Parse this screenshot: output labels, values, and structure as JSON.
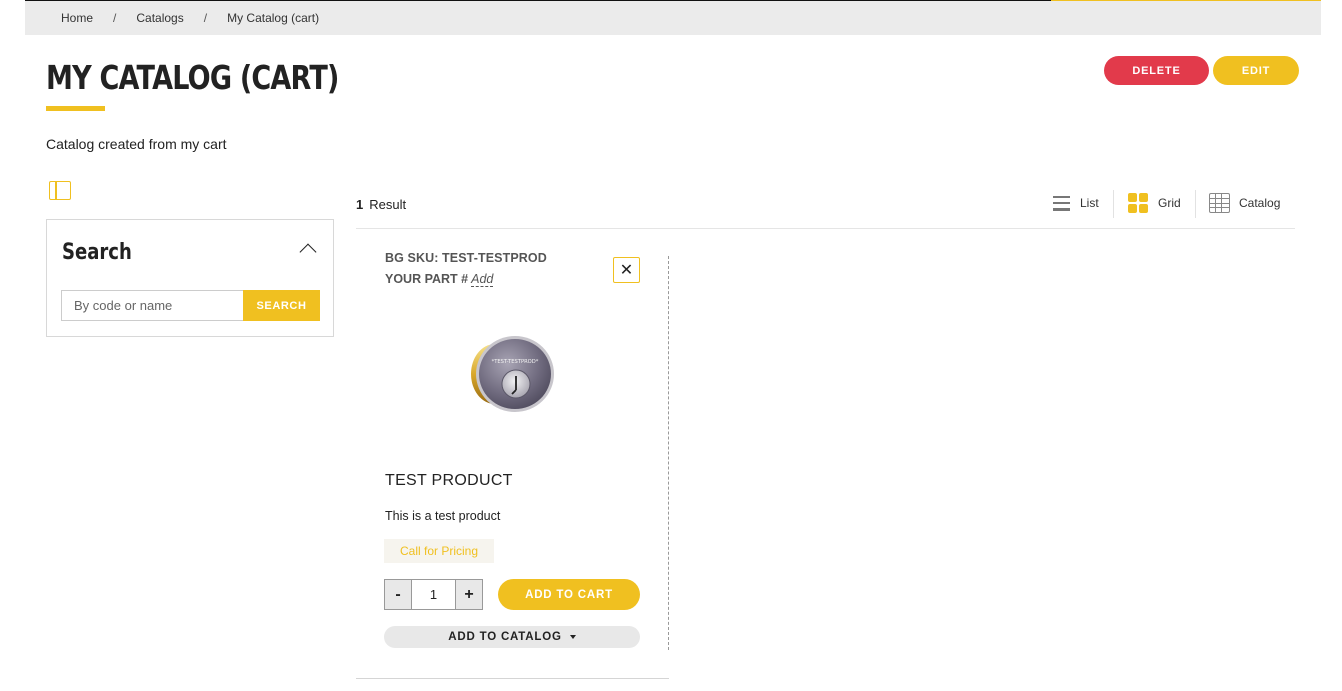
{
  "breadcrumb": {
    "items": [
      "Home",
      "Catalogs",
      "My Catalog (cart)"
    ],
    "separator": "/"
  },
  "page": {
    "title": "MY CATALOG (CART)",
    "description": "Catalog created from my cart"
  },
  "actions": {
    "delete_label": "DELETE",
    "edit_label": "EDIT"
  },
  "search": {
    "heading": "Search",
    "placeholder": "By code or name",
    "button_label": "SEARCH"
  },
  "results": {
    "count": "1",
    "label": "Result"
  },
  "views": {
    "list_label": "List",
    "grid_label": "Grid",
    "catalog_label": "Catalog"
  },
  "product": {
    "sku_text": "BG SKU: TEST-TESTPROD",
    "part_label": "YOUR PART #",
    "part_add": "Add",
    "image_text": "*TEST-TESTPROD*",
    "name": "TEST PRODUCT",
    "description": "This is a test product",
    "pricing": "Call for Pricing",
    "quantity": "1",
    "minus": "-",
    "plus": "+",
    "add_to_cart": "ADD TO CART",
    "add_to_catalog": "ADD TO CATALOG",
    "remove_symbol": "✕"
  },
  "colors": {
    "accent": "#f0c020",
    "danger": "#e23a4b"
  }
}
